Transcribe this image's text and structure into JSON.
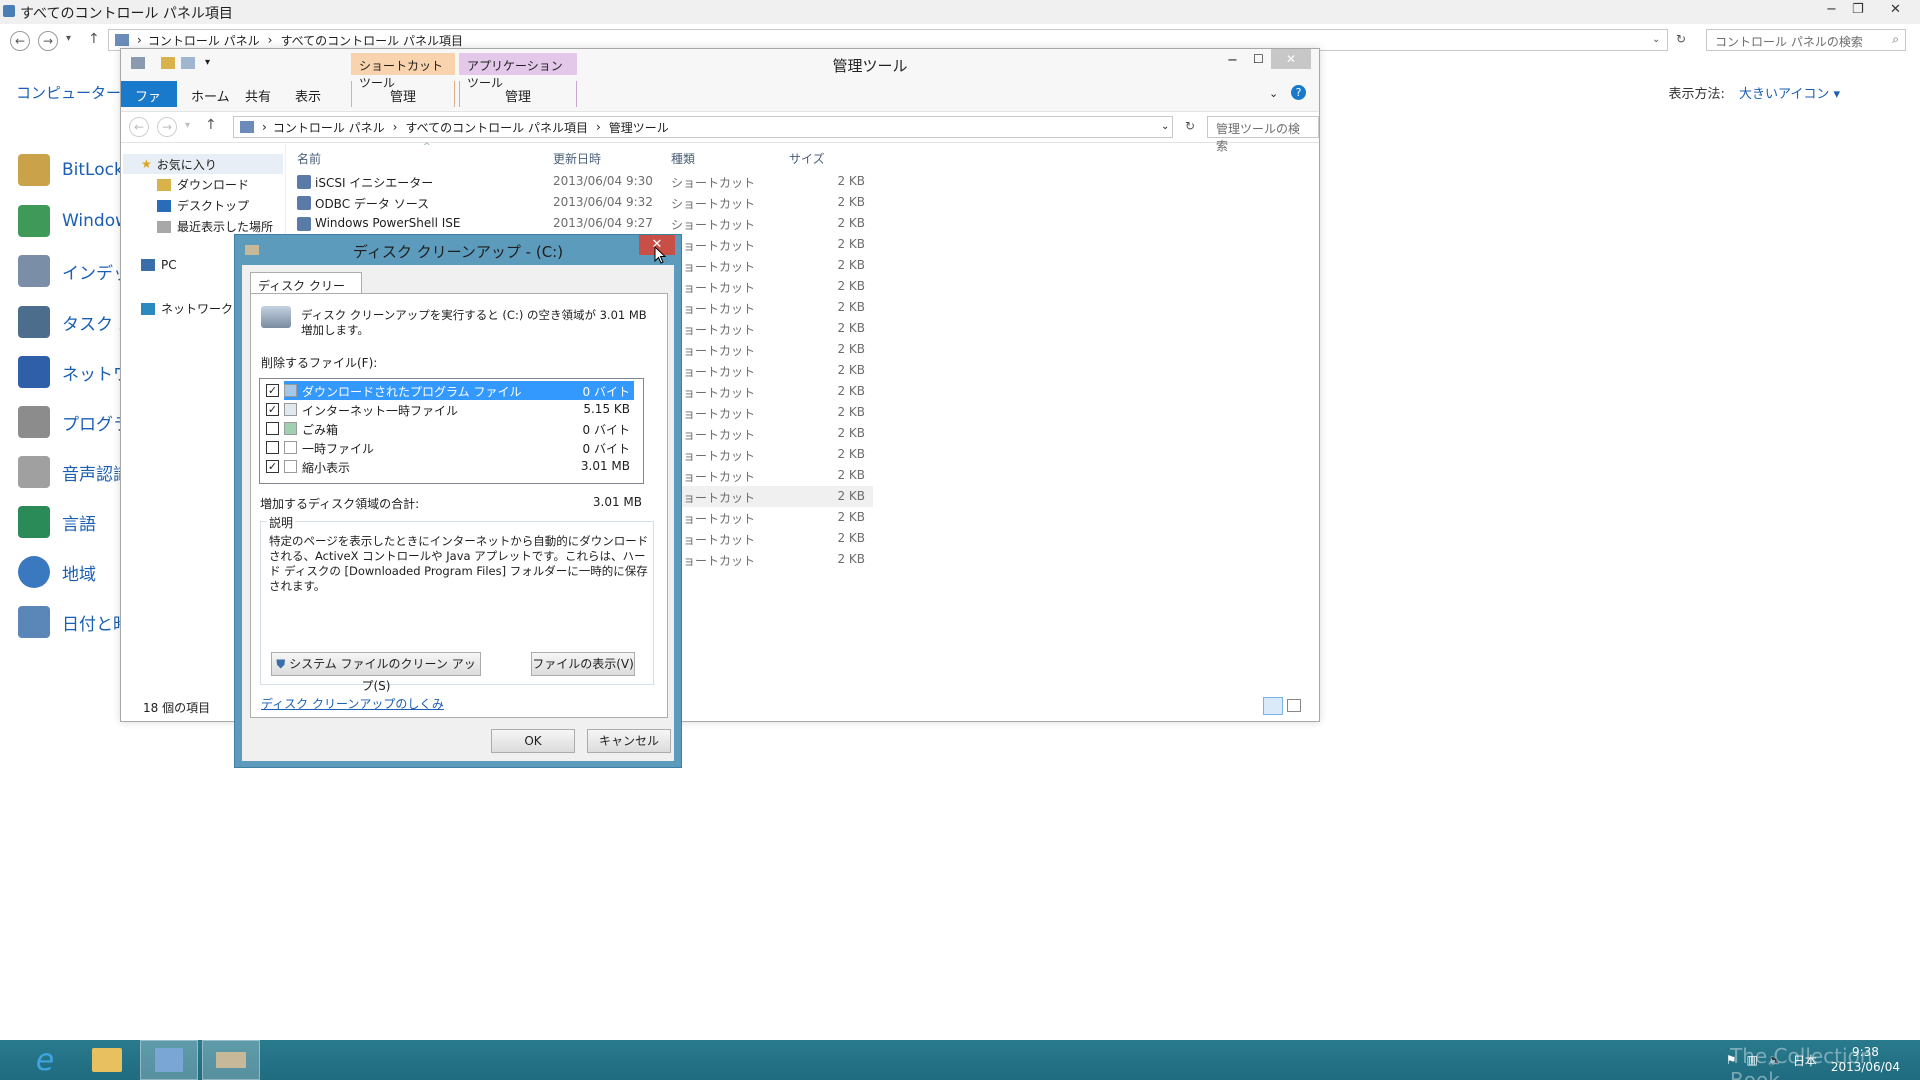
{
  "control_panel": {
    "title": "すべてのコントロール パネル項目",
    "breadcrumb": [
      "コントロール パネル",
      "すべてのコントロール パネル項目"
    ],
    "search_placeholder": "コントロール パネルの検索",
    "left_title": "コンピューターの設",
    "view_label": "表示方法:",
    "view_value": "大きいアイコン ▾",
    "items": [
      {
        "label": "BitLock",
        "icon": "bitlocker-icon"
      },
      {
        "label": "Window",
        "icon": "windows-firewall-icon"
      },
      {
        "label": "インデック",
        "icon": "indexing-icon"
      },
      {
        "label": "タスク バ",
        "icon": "taskbar-icon"
      },
      {
        "label": "ネットワー",
        "icon": "network-icon"
      },
      {
        "label": "プログラム",
        "icon": "programs-icon"
      },
      {
        "label": "音声認識",
        "icon": "microphone-icon"
      },
      {
        "label": "言語",
        "icon": "language-icon"
      },
      {
        "label": "地域",
        "icon": "region-globe-icon"
      },
      {
        "label": "日付と時",
        "icon": "calendar-clock-icon"
      }
    ]
  },
  "admin_tools": {
    "title": "管理ツール",
    "tool_tabs": {
      "shortcut_tools": "ショートカット ツール",
      "app_tools": "アプリケーション ツール",
      "manage1": "管理",
      "manage2": "管理"
    },
    "ribbon_tabs": {
      "file": "ファイル",
      "home": "ホーム",
      "share": "共有",
      "view": "表示"
    },
    "breadcrumb": [
      "コントロール パネル",
      "すべてのコントロール パネル項目",
      "管理ツール"
    ],
    "search_placeholder": "管理ツールの検索",
    "tree": {
      "favorites": "お気に入り",
      "downloads": "ダウンロード",
      "desktop": "デスクトップ",
      "recent": "最近表示した場所",
      "pc": "PC",
      "network": "ネットワーク"
    },
    "columns": {
      "name": "名前",
      "date": "更新日時",
      "type": "種類",
      "size": "サイズ"
    },
    "files": [
      {
        "name": "iSCSI イニシエーター",
        "date": "2013/06/04 9:30",
        "type": "ショートカット",
        "size": "2 KB"
      },
      {
        "name": "ODBC データ ソース",
        "date": "2013/06/04 9:32",
        "type": "ショートカット",
        "size": "2 KB"
      },
      {
        "name": "Windows PowerShell ISE",
        "date": "2013/06/04 9:27",
        "type": "ショートカット",
        "size": "2 KB"
      }
    ],
    "hidden_rows": [
      {
        "type": "ショートカット",
        "size": "2 KB"
      },
      {
        "type": "ショートカット",
        "size": "2 KB"
      },
      {
        "type": "ショートカット",
        "size": "2 KB"
      },
      {
        "type": "ショートカット",
        "size": "2 KB"
      },
      {
        "type": "ショートカット",
        "size": "2 KB"
      },
      {
        "type": "ショートカット",
        "size": "2 KB"
      },
      {
        "type": "ショートカット",
        "size": "2 KB"
      },
      {
        "type": "ショートカット",
        "size": "2 KB"
      },
      {
        "type": "ショートカット",
        "size": "2 KB"
      },
      {
        "type": "ショートカット",
        "size": "2 KB"
      },
      {
        "type": "ショートカット",
        "size": "2 KB"
      },
      {
        "type": "ショートカット",
        "size": "2 KB"
      },
      {
        "type": "ショートカット",
        "size": "2 KB"
      },
      {
        "type": "ショートカット",
        "size": "2 KB"
      },
      {
        "type": "ショートカット",
        "size": "2 KB"
      },
      {
        "type": "ショートカット",
        "size": "2 KB"
      }
    ],
    "status": "18 個の項目"
  },
  "disk_cleanup": {
    "title": "ディスク クリーンアップ - (C:)",
    "tab": "ディスク クリーンアップ",
    "intro": "ディスク クリーンアップを実行すると (C:) の空き領域が 3.01 MB 増加します。",
    "list_label": "削除するファイル(F):",
    "items": [
      {
        "name": "ダウンロードされたプログラム ファイル",
        "size": "0 バイト",
        "checked": true
      },
      {
        "name": "インターネット一時ファイル",
        "size": "5.15 KB",
        "checked": true
      },
      {
        "name": "ごみ箱",
        "size": "0 バイト",
        "checked": false
      },
      {
        "name": "一時ファイル",
        "size": "0 バイト",
        "checked": false
      },
      {
        "name": "縮小表示",
        "size": "3.01 MB",
        "checked": true
      }
    ],
    "total_label": "増加するディスク領域の合計:",
    "total_value": "3.01 MB",
    "desc_label": "説明",
    "description": "特定のページを表示したときにインターネットから自動的にダウンロードされる、ActiveX コントロールや Java アプレットです。これらは、ハード ディスクの [Downloaded Program Files] フォルダーに一時的に保存されます。",
    "btn_system": "システム ファイルのクリーン アップ(S)",
    "btn_view_files": "ファイルの表示(V)",
    "help_link": "ディスク クリーンアップのしくみ",
    "ok": "OK",
    "cancel": "キャンセル"
  },
  "taskbar": {
    "lang": "日本",
    "time": "9:38",
    "date": "2013/06/04",
    "watermark": "The Collection Book"
  }
}
